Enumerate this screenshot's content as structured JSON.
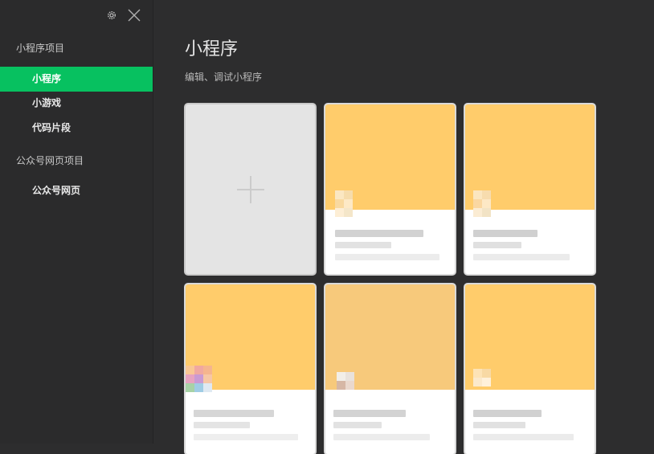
{
  "sidebar": {
    "section_miniprogram": "小程序项目",
    "items": [
      {
        "label": "小程序",
        "active": true
      },
      {
        "label": "小游戏",
        "active": false
      },
      {
        "label": "代码片段",
        "active": false
      }
    ],
    "section_official": "公众号网页项目",
    "official_items": [
      {
        "label": "公众号网页"
      }
    ],
    "settings_icon": "gear-icon",
    "close_icon": "close-icon"
  },
  "main": {
    "title": "小程序",
    "subtitle": "编辑、调试小程序"
  },
  "colors": {
    "accent": "#07c160",
    "card_cover": "#ffcc6b",
    "background": "#2d2d2e"
  }
}
